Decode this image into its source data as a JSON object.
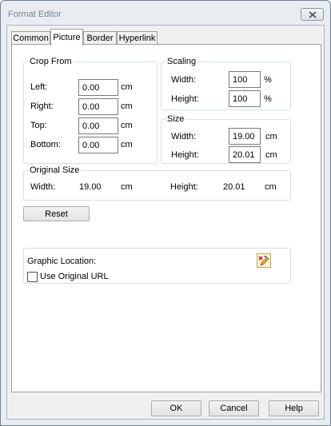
{
  "window": {
    "title": "Format Editor"
  },
  "tabs": [
    {
      "label": "Common",
      "active": false
    },
    {
      "label": "Picture",
      "active": true
    },
    {
      "label": "Border",
      "active": false
    },
    {
      "label": "Hyperlink",
      "active": false
    }
  ],
  "crop_from": {
    "title": "Crop From",
    "unit": "cm",
    "fields": [
      {
        "label": "Left:",
        "value": "0.00"
      },
      {
        "label": "Right:",
        "value": "0.00"
      },
      {
        "label": "Top:",
        "value": "0.00"
      },
      {
        "label": "Bottom:",
        "value": "0.00"
      }
    ]
  },
  "scaling": {
    "title": "Scaling",
    "unit": "%",
    "fields": [
      {
        "label": "Width:",
        "value": "100"
      },
      {
        "label": "Height:",
        "value": "100"
      }
    ]
  },
  "size": {
    "title": "Size",
    "unit": "cm",
    "fields": [
      {
        "label": "Width:",
        "value": "19.00"
      },
      {
        "label": "Height:",
        "value": "20.01"
      }
    ]
  },
  "original_size": {
    "title": "Original Size",
    "width_label": "Width:",
    "width_value": "19.00",
    "width_unit": "cm",
    "height_label": "Height:",
    "height_value": "20.01",
    "height_unit": "cm"
  },
  "reset_label": "Reset",
  "graphic_location": {
    "label": "Graphic Location:",
    "checkbox_label": "Use Original URL",
    "checked": false,
    "edit_icon": "edit-pencil-icon"
  },
  "buttons": {
    "ok": "OK",
    "cancel": "Cancel",
    "help": "Help"
  }
}
